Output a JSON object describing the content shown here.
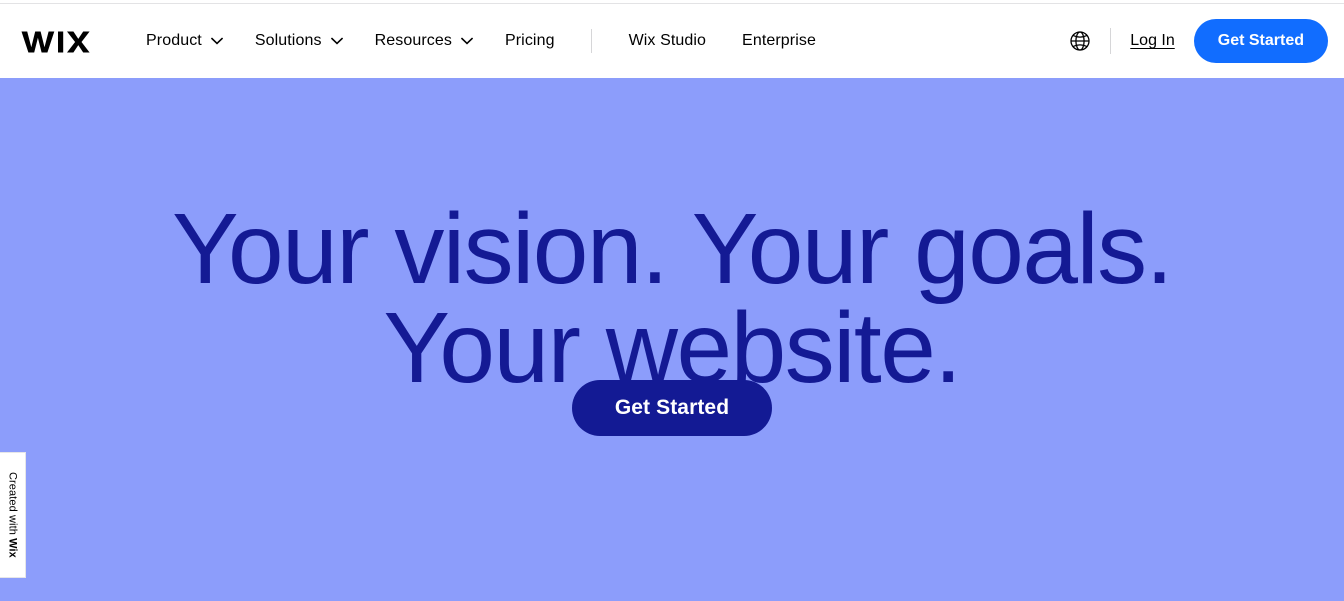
{
  "brand": {
    "logo_text": "WIX",
    "logo_color": "#000000"
  },
  "colors": {
    "hero_background": "#8c9dfb",
    "hero_text": "#141a94",
    "nav_cta_background": "#116dff",
    "hero_cta_background": "#131a94",
    "navbar_background": "#ffffff"
  },
  "navbar": {
    "items": [
      {
        "label": "Product",
        "has_caret": true
      },
      {
        "label": "Solutions",
        "has_caret": true
      },
      {
        "label": "Resources",
        "has_caret": true
      },
      {
        "label": "Pricing",
        "has_caret": false
      },
      {
        "label": "Wix Studio",
        "has_caret": false
      },
      {
        "label": "Enterprise",
        "has_caret": false
      }
    ],
    "language_icon": "globe-icon",
    "login_label": "Log In",
    "cta_label": "Get Started"
  },
  "hero": {
    "headline_line_1": "Your vision. Your goals.",
    "headline_line_2": "Your website.",
    "headline": "Your vision. Your goals.\nYour website.",
    "cta_label": "Get Started"
  },
  "badge": {
    "prefix": "Created with ",
    "brand": "Wix"
  }
}
